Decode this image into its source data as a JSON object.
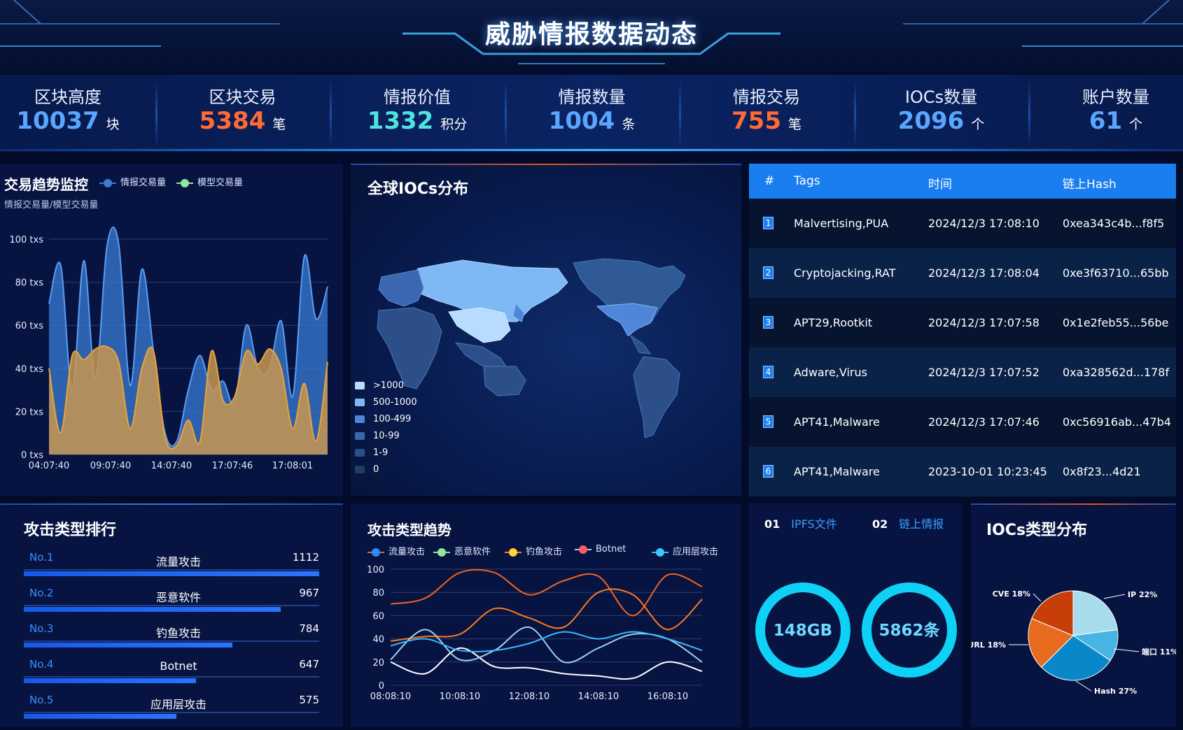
{
  "header": {
    "title": "威胁情报数据动态"
  },
  "stats": [
    {
      "label": "区块高度",
      "value": "10037",
      "unit": "块",
      "color": "#5aa6ff"
    },
    {
      "label": "区块交易",
      "value": "5384",
      "unit": "笔",
      "color": "#ff6a35"
    },
    {
      "label": "情报价值",
      "value": "1332",
      "unit": "积分",
      "color": "#4fe3e0"
    },
    {
      "label": "情报数量",
      "value": "1004",
      "unit": "条",
      "color": "#5aa6ff"
    },
    {
      "label": "情报交易",
      "value": "755",
      "unit": "笔",
      "color": "#ff6a35"
    },
    {
      "label": "IOCs数量",
      "value": "2096",
      "unit": "个",
      "color": "#5aa6ff"
    },
    {
      "label": "账户数量",
      "value": "61",
      "unit": "个",
      "color": "#5aa6ff"
    }
  ],
  "trend_panel": {
    "title": "交易趋势监控",
    "subtitle": "情报交易量/模型交易量",
    "legend": [
      "情报交易量",
      "模型交易量"
    ],
    "chart_data": {
      "type": "area",
      "x_ticks": [
        "04:07:40",
        "09:07:40",
        "14:07:40",
        "17:07:46",
        "17:08:01"
      ],
      "y_ticks": [
        "100 txs",
        "80 txs",
        "60 txs",
        "40 txs",
        "20 txs",
        "0 txs"
      ],
      "ylim": [
        0,
        100
      ],
      "series": [
        {
          "name": "情报交易量",
          "color": "#3a7bd5",
          "values": [
            70,
            88,
            30,
            90,
            35,
            97,
            98,
            32,
            86,
            48,
            10,
            6,
            30,
            46,
            30,
            34,
            24,
            60,
            40,
            40,
            62,
            27,
            92,
            63,
            78
          ]
        },
        {
          "name": "模型交易量",
          "color": "#d99a3a",
          "values": [
            40,
            10,
            46,
            44,
            49,
            50,
            43,
            12,
            40,
            48,
            8,
            4,
            16,
            6,
            48,
            25,
            27,
            48,
            42,
            49,
            40,
            12,
            33,
            6,
            43
          ]
        }
      ]
    }
  },
  "map_panel": {
    "title": "全球IOCs分布",
    "legend": [
      {
        "label": ">1000",
        "color": "#b7dcff"
      },
      {
        "label": "500-1000",
        "color": "#7fb9f5"
      },
      {
        "label": "100-499",
        "color": "#4f86d9"
      },
      {
        "label": "10-99",
        "color": "#3a67b0"
      },
      {
        "label": "1-9",
        "color": "#2c4f8a"
      },
      {
        "label": "0",
        "color": "#223c66"
      }
    ]
  },
  "hash_table": {
    "headers": [
      "#",
      "Tags",
      "时间",
      "链上Hash"
    ],
    "rows": [
      {
        "idx": "1",
        "tags": "Malvertising,PUA",
        "time": "2024/12/3 17:08:10",
        "hash": "0xea343c4b...f8f5"
      },
      {
        "idx": "2",
        "tags": "Cryptojacking,RAT",
        "time": "2024/12/3 17:08:04",
        "hash": "0xe3f63710...65bb"
      },
      {
        "idx": "3",
        "tags": "APT29,Rootkit",
        "time": "2024/12/3 17:07:58",
        "hash": "0x1e2feb55...56be"
      },
      {
        "idx": "4",
        "tags": "Adware,Virus",
        "time": "2024/12/3 17:07:52",
        "hash": "0xa328562d...178f"
      },
      {
        "idx": "5",
        "tags": "APT41,Malware",
        "time": "2024/12/3 17:07:46",
        "hash": "0xc56916ab...47b4"
      },
      {
        "idx": "6",
        "tags": "APT41,Malware",
        "time": "2023-10-01 10:23:45",
        "hash": "0x8f23...4d21"
      }
    ]
  },
  "ranking_panel": {
    "title": "攻击类型排行",
    "items": [
      {
        "no": "No.1",
        "name": "流量攻击",
        "value": "1112",
        "pct": 1.0
      },
      {
        "no": "No.2",
        "name": "恶意软件",
        "value": "967",
        "pct": 0.87
      },
      {
        "no": "No.3",
        "name": "钓鱼攻击",
        "value": "784",
        "pct": 0.705
      },
      {
        "no": "No.4",
        "name": "Botnet",
        "value": "647",
        "pct": 0.582
      },
      {
        "no": "No.5",
        "name": "应用层攻击",
        "value": "575",
        "pct": 0.517
      }
    ]
  },
  "attack_trend_panel": {
    "title": "攻击类型趋势",
    "chart_data": {
      "type": "line",
      "x_ticks": [
        "08:08:10",
        "10:08:10",
        "12:08:10",
        "14:08:10",
        "16:08:10"
      ],
      "y_ticks": [
        "100",
        "80",
        "60",
        "40",
        "20",
        "0"
      ],
      "ylim": [
        0,
        100
      ],
      "series": [
        {
          "name": "流量攻击",
          "color": "#f0641e",
          "values": [
            70,
            75,
            97,
            97,
            78,
            90,
            94,
            60,
            95,
            85
          ]
        },
        {
          "name": "恶意软件",
          "color": "#ffffff",
          "values": [
            20,
            10,
            32,
            16,
            15,
            10,
            8,
            6,
            20,
            12
          ]
        },
        {
          "name": "钓鱼攻击",
          "color": "#ff7a1c",
          "values": [
            38,
            42,
            44,
            66,
            58,
            50,
            80,
            78,
            48,
            74
          ]
        },
        {
          "name": "Botnet",
          "color": "#9fd3f0",
          "values": [
            22,
            48,
            22,
            30,
            50,
            20,
            32,
            44,
            40,
            20
          ]
        },
        {
          "name": "应用层攻击",
          "color": "#3ab8ff",
          "values": [
            34,
            40,
            30,
            30,
            36,
            46,
            40,
            46,
            40,
            30
          ]
        }
      ]
    }
  },
  "storage_panel": {
    "tabs": [
      {
        "num": "01",
        "label": "IPFS文件"
      },
      {
        "num": "02",
        "label": "链上情报"
      }
    ],
    "rings": [
      "148GB",
      "5862条"
    ]
  },
  "ioc_type_panel": {
    "title": "IOCs类型分布",
    "chart_data": {
      "type": "pie",
      "slices": [
        {
          "label": "IP 22%",
          "value": 22,
          "color": "#a7dcec"
        },
        {
          "label": "端口 11%",
          "value": 11,
          "color": "#47b4e4"
        },
        {
          "label": "Hash 27%",
          "value": 27,
          "color": "#0a87c8"
        },
        {
          "label": "URL 18%",
          "value": 18,
          "color": "#e86a1e"
        },
        {
          "label": "CVE 18%",
          "value": 18,
          "color": "#c73e08"
        }
      ]
    }
  }
}
